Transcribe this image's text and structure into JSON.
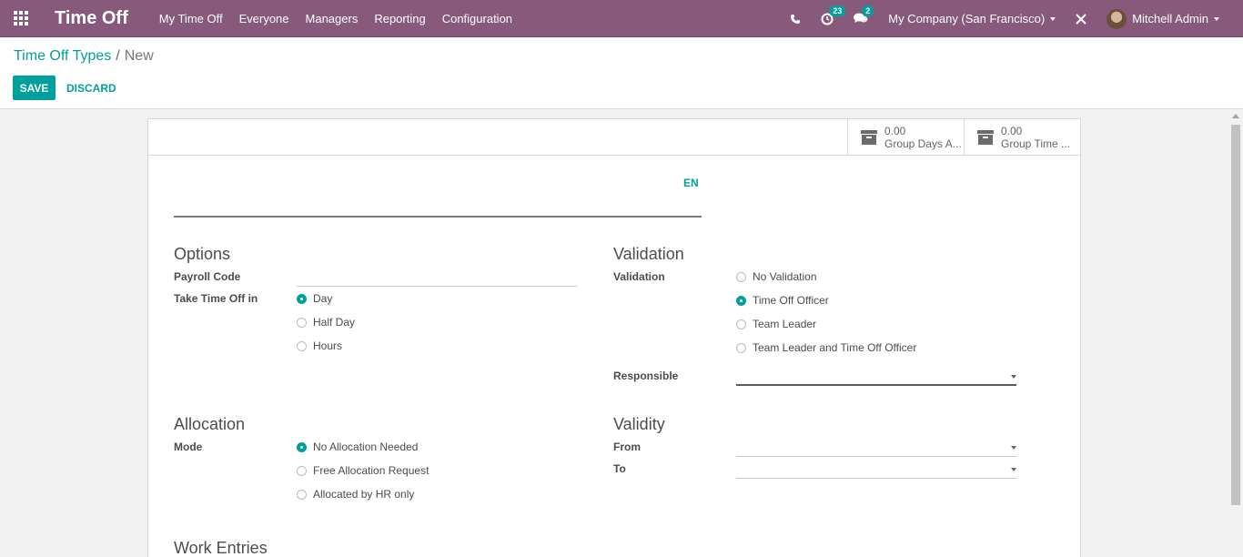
{
  "navbar": {
    "app_title": "Time Off",
    "menu": [
      "My Time Off",
      "Everyone",
      "Managers",
      "Reporting",
      "Configuration"
    ],
    "activity_count": "23",
    "message_count": "2",
    "company": "My Company (San Francisco)",
    "user": "Mitchell Admin"
  },
  "breadcrumb": {
    "parent": "Time Off Types",
    "separator": "/",
    "current": "New"
  },
  "actions": {
    "save": "SAVE",
    "discard": "DISCARD"
  },
  "stat_buttons": [
    {
      "value": "0.00",
      "label": "Group Days A..."
    },
    {
      "value": "0.00",
      "label": "Group Time ..."
    }
  ],
  "form": {
    "lang": "EN",
    "name_value": "",
    "options": {
      "title": "Options",
      "payroll_code_label": "Payroll Code",
      "payroll_code_value": "",
      "take_time_off_label": "Take Time Off in",
      "take_time_off_choices": [
        "Day",
        "Half Day",
        "Hours"
      ],
      "take_time_off_selected": "Day"
    },
    "validation": {
      "title": "Validation",
      "validation_label": "Validation",
      "choices": [
        "No Validation",
        "Time Off Officer",
        "Team Leader",
        "Team Leader and Time Off Officer"
      ],
      "selected": "Time Off Officer",
      "responsible_label": "Responsible",
      "responsible_value": ""
    },
    "allocation": {
      "title": "Allocation",
      "mode_label": "Mode",
      "choices": [
        "No Allocation Needed",
        "Free Allocation Request",
        "Allocated by HR only"
      ],
      "selected": "No Allocation Needed"
    },
    "validity": {
      "title": "Validity",
      "from_label": "From",
      "from_value": "",
      "to_label": "To",
      "to_value": ""
    },
    "work_entries": {
      "title": "Work Entries"
    }
  },
  "colors": {
    "navbar": "#875a7b",
    "accent": "#00a09d"
  }
}
